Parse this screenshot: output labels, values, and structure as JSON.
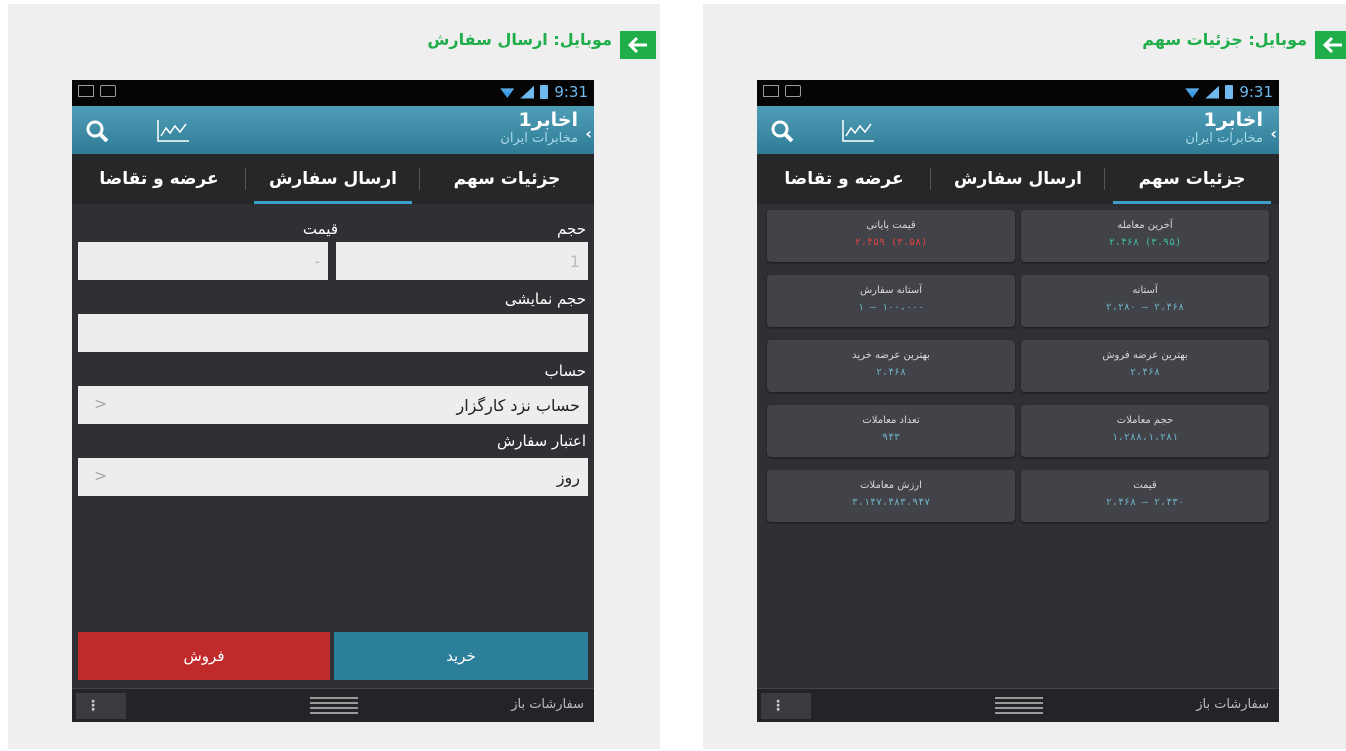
{
  "left_panel": {
    "title": "موبایل: ارسال سفارش",
    "phone": {
      "status_time": "9:31",
      "app_title": "اخابر1",
      "app_subtitle": "مخابرات ایران",
      "tabs": [
        "جزئیات سهم",
        "ارسال سفارش",
        "عرضه و تقاضا"
      ],
      "active_tab": 1,
      "form": {
        "volume_label": "حجم",
        "price_label": "قیمت",
        "volume_value": "1",
        "price_value": "-",
        "display_volume_label": "حجم نمایشی",
        "display_volume_value": "",
        "account_label": "حساب",
        "account_value": "حساب نزد کارگزار",
        "validity_label": "اعتبار سفارش",
        "validity_value": "روز"
      },
      "buy_label": "خرید",
      "sell_label": "فروش",
      "bottom_text": "سفارشات باز"
    }
  },
  "right_panel": {
    "title": "موبایل: جزئیات سهم",
    "phone": {
      "status_time": "9:31",
      "app_title": "اخابر1",
      "app_subtitle": "مخابرات ایران",
      "tabs": [
        "جزئیات سهم",
        "ارسال سفارش",
        "عرضه و تقاضا"
      ],
      "active_tab": 0,
      "details": [
        {
          "label": "آخرین معامله",
          "value": "۲،۴۶۸ (۳.۹۵)",
          "color": "#3fbf9f"
        },
        {
          "label": "قیمت پایانی",
          "value": "۲،۴۵۹ (۳.۵۸)",
          "color": "#e0433c"
        },
        {
          "label": "آستانه",
          "value": "۲،۲۸۰ – ۲،۴۶۸",
          "color": "#6fb2c7"
        },
        {
          "label": "آستانه سفارش",
          "value": "۱ – ۱۰۰،۰۰۰",
          "color": "#6fb2c7"
        },
        {
          "label": "بهترین عرضه فروش",
          "value": "۲،۴۶۸",
          "color": "#6fb2c7"
        },
        {
          "label": "بهترین عرضه خرید",
          "value": "۲،۴۶۸",
          "color": "#6fb2c7"
        },
        {
          "label": "حجم معاملات",
          "value": "۱،۲۸۸،۱،۲۸۱",
          "color": "#6fb2c7"
        },
        {
          "label": "تعداد معاملات",
          "value": "۹۴۳",
          "color": "#6fb2c7"
        },
        {
          "label": "قیمت",
          "value": "۲،۴۶۸ – ۲،۴۳۰",
          "color": "#6fb2c7"
        },
        {
          "label": "ارزش معاملات",
          "value": "۳،۱۴۷،۴۸۳،۹۴۷",
          "color": "#6fb2c7"
        }
      ],
      "bottom_text": "سفارشات باز"
    }
  }
}
